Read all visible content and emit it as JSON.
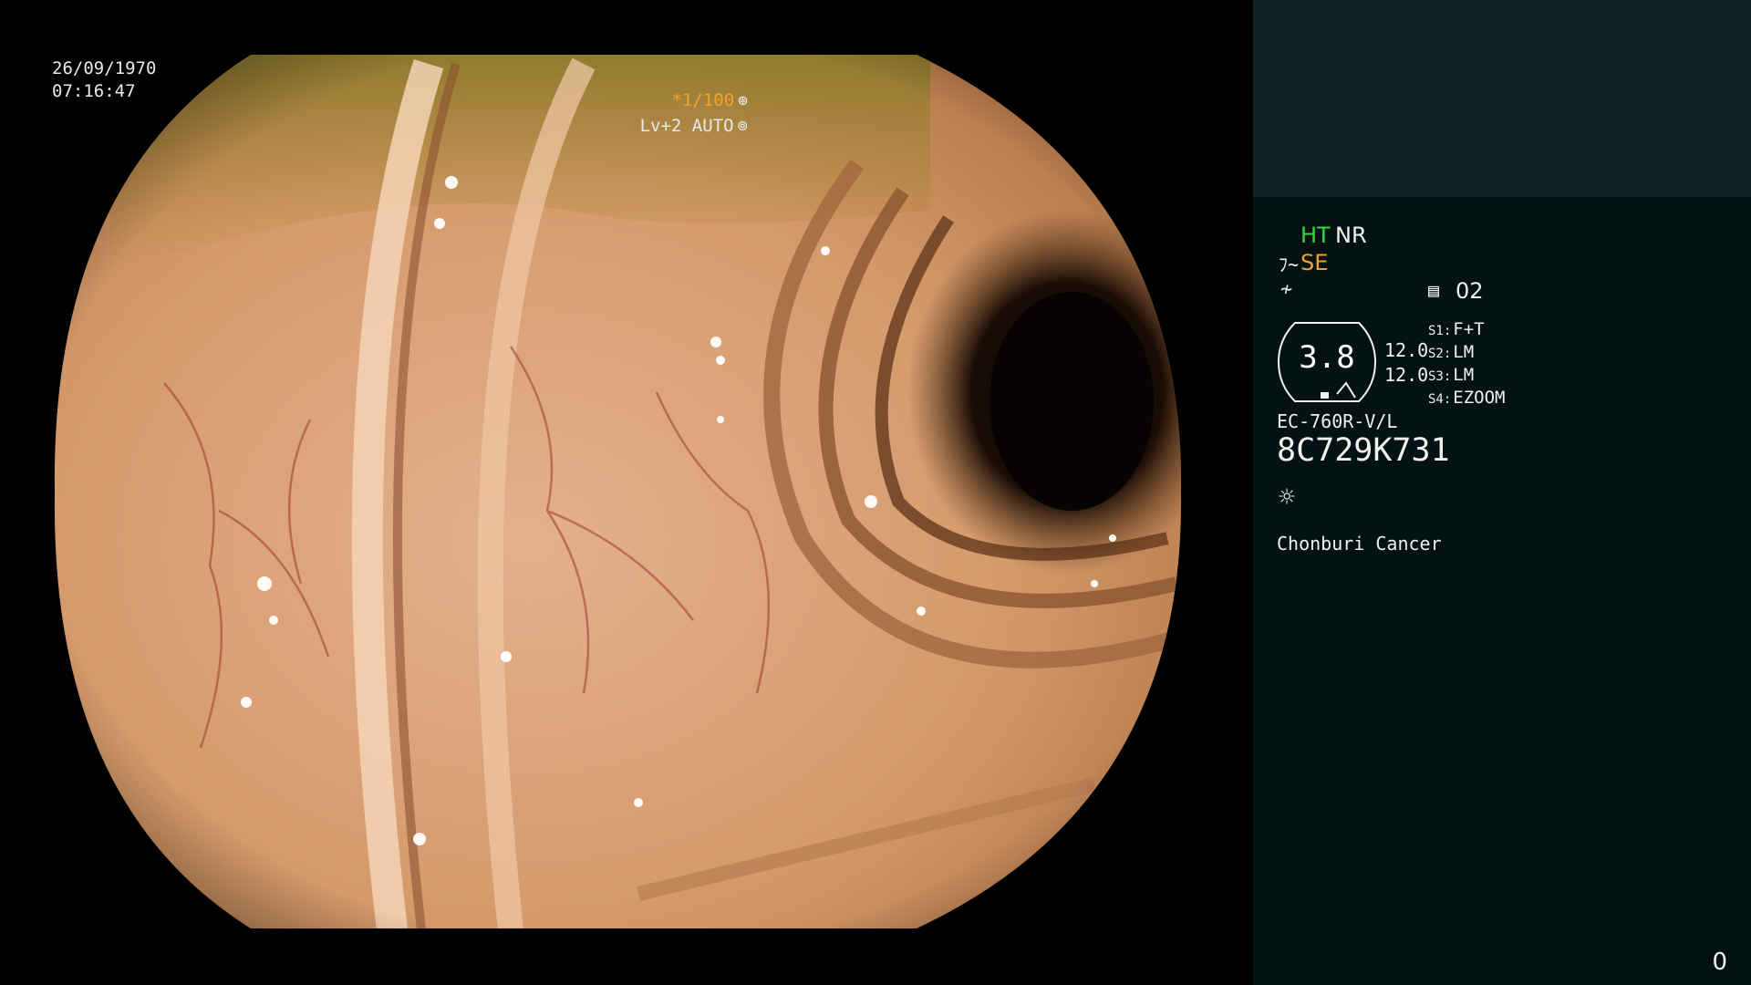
{
  "timestamp": {
    "date": "26/09/1970",
    "time": "07:16:47"
  },
  "overlay": {
    "shutter": "*1/100",
    "shutter_icon": "aperture-icon",
    "light_level": "Lv+2 AUTO",
    "light_icon": "iris-icon"
  },
  "info": {
    "ht": "HT",
    "nr": "NR",
    "se": "SE",
    "se_icon": "structure-enhance-icon",
    "filter_icon": "filter-icon",
    "memo_icon": "memo-icon",
    "memo_value": "02",
    "zoom_value": "3.8",
    "zoom_right_1": "12.0",
    "zoom_right_2": "12.0",
    "switches": [
      {
        "key": "S1:",
        "value": "F+T"
      },
      {
        "key": "S2:",
        "value": "LM"
      },
      {
        "key": "S3:",
        "value": "LM"
      },
      {
        "key": "S4:",
        "value": "EZOOM"
      }
    ],
    "scope_model": "EC-760R-V/L",
    "scope_serial": "8C729K731",
    "light_source_icon": "sun-icon",
    "facility": "Chonburi Cancer",
    "counter": "0"
  },
  "colors": {
    "accent_orange": "#f2a12a",
    "accent_green": "#3fd04a",
    "panel_bg": "#051212",
    "panel_top_bg": "#0e2325",
    "tissue_light": "#e1a27f",
    "tissue_mid": "#c2864f",
    "lumen_dark": "#120a06"
  }
}
